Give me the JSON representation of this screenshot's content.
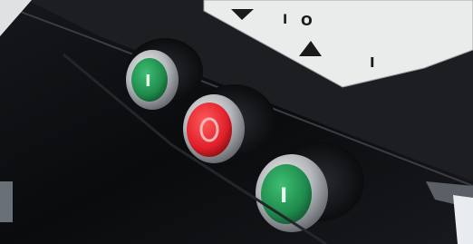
{
  "panel_label": {
    "symbol_on_upper": "I",
    "symbol_off": "O",
    "symbol_on_lower": "I",
    "arrow_icons": [
      "arrow-down-icon",
      "arrow-up-icon"
    ]
  },
  "buttons": [
    {
      "id": "start-button-upper",
      "glyph": "I",
      "color": "#1f8a4c"
    },
    {
      "id": "stop-button",
      "glyph": "O",
      "color": "#e0202a"
    },
    {
      "id": "start-button-lower",
      "glyph": "I",
      "color": "#1f8a4c"
    }
  ],
  "colors": {
    "panel_black": "#0b0c0e",
    "bezel_silver": "#b9bcc0",
    "label_white": "#e9ecea"
  }
}
